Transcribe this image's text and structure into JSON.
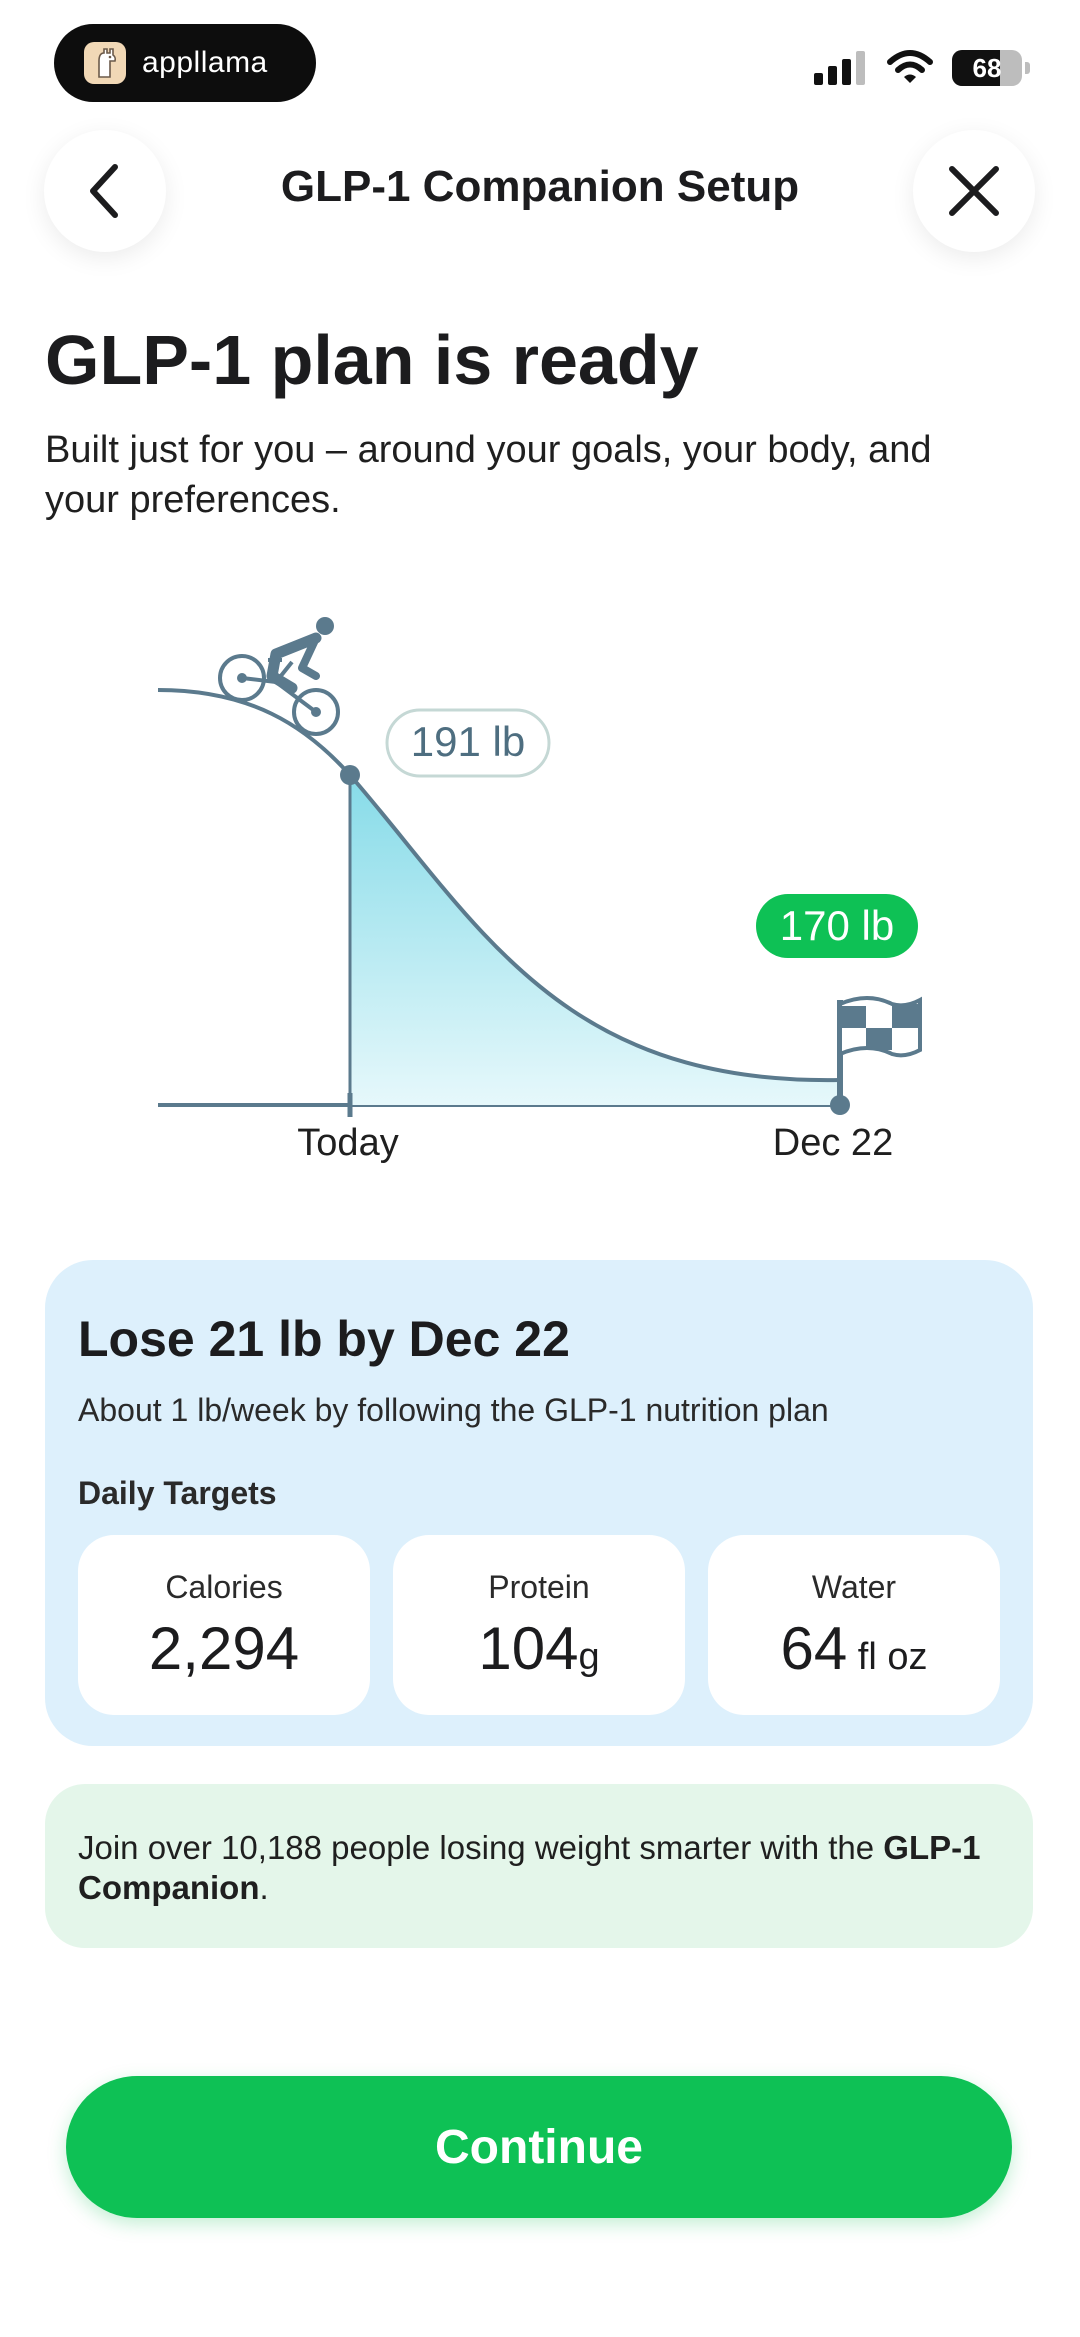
{
  "status_bar": {
    "app_name": "appllama",
    "battery": "68",
    "battery_level_percent": 68
  },
  "header": {
    "title": "GLP-1 Companion Setup",
    "back_icon": "chevron-left-icon",
    "close_icon": "close-icon"
  },
  "main": {
    "title": "GLP-1 plan is ready",
    "subtitle": "Built just for you – around your goals, your body, and your preferences."
  },
  "chart": {
    "start_weight_label": "191 lb",
    "goal_weight_label": "170 lb",
    "start_date_label": "Today",
    "end_date_label": "Dec 22",
    "start_icon": "cyclist-icon",
    "goal_icon": "checkered-flag-icon"
  },
  "chart_data": {
    "type": "area",
    "x": [
      "Today",
      "Dec 22"
    ],
    "series": [
      {
        "values": [
          191,
          170
        ]
      }
    ]
  },
  "summary": {
    "title": "Lose 21 lb by Dec 22",
    "subtitle": "About 1 lb/week by following the GLP-1 nutrition plan",
    "targets_label": "Daily Targets",
    "targets": [
      {
        "label": "Calories",
        "value": "2,294",
        "unit": ""
      },
      {
        "label": "Protein",
        "value": "104",
        "unit": "g"
      },
      {
        "label": "Water",
        "value": "64",
        "unit": " fl oz"
      }
    ]
  },
  "community": {
    "text_prefix": "Join over 10,188 people losing weight smarter with the ",
    "brand": "GLP-1 Companion",
    "text_suffix": "."
  },
  "cta": {
    "label": "Continue"
  },
  "colors": {
    "accent_green": "#0ec155",
    "chart_line": "#5b7a8d",
    "card_blue": "#ddf0fc",
    "card_green": "#e4f6ea"
  }
}
